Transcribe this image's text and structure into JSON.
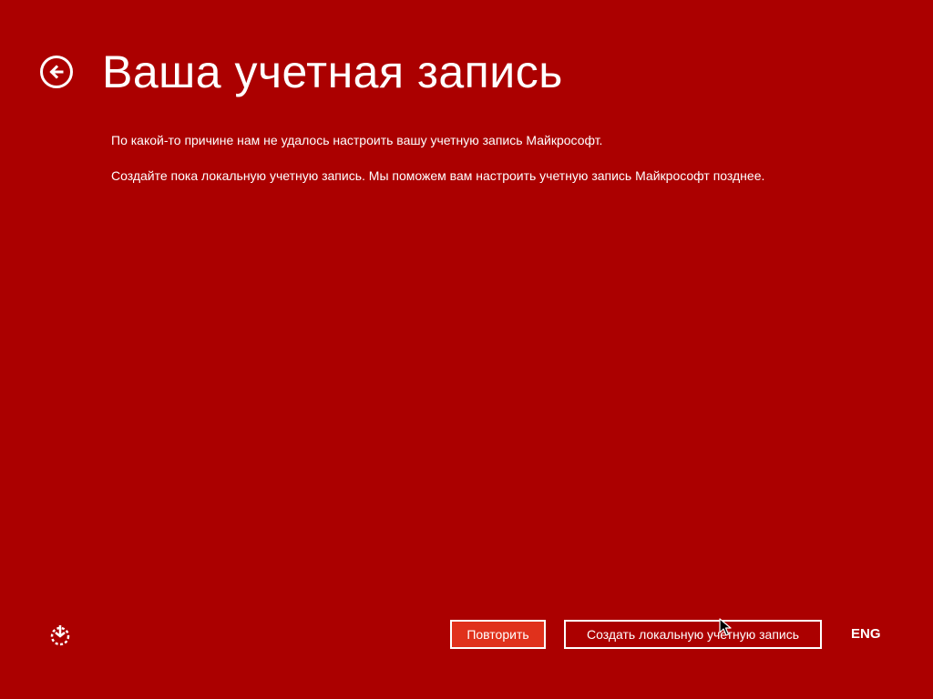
{
  "header": {
    "title": "Ваша учетная запись",
    "back_icon": "back-arrow-icon"
  },
  "messages": [
    "По какой-то причине нам не удалось настроить вашу учетную запись Майкрософт.",
    "Создайте пока локальную учетную запись. Мы поможем вам настроить учетную запись Майкрософт позднее."
  ],
  "footer": {
    "ease_of_access_icon": "ease-of-access-icon",
    "retry_label": "Повторить",
    "create_local_label": "Создать локальную учетную запись",
    "language": "ENG"
  },
  "colors": {
    "background": "#ab0000",
    "primary_button": "#e0311c",
    "text": "#ffffff"
  }
}
